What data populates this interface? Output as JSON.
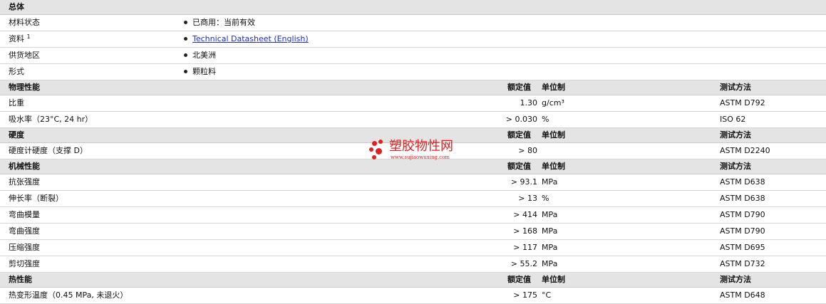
{
  "rows": [
    {
      "type": "hdr",
      "name": "总体"
    },
    {
      "type": "bullet",
      "name": "材料状态",
      "bullet": "已商用：当前有效"
    },
    {
      "type": "bullet",
      "name": "资料",
      "sup": "1",
      "bullet": "Technical Datasheet (English)",
      "link": true
    },
    {
      "type": "bullet",
      "name": "供货地区",
      "bullet": "北美洲"
    },
    {
      "type": "bullet",
      "name": "形式",
      "bullet": "颗粒料"
    },
    {
      "type": "hdr",
      "name": "物理性能",
      "rated": "额定值",
      "unit": "单位制",
      "test": "测试方法"
    },
    {
      "type": "data",
      "name": "比重",
      "value": "1.30",
      "unit": "g/cm³",
      "test": "ASTM D792"
    },
    {
      "type": "data",
      "name": "吸水率（23°C, 24 hr）",
      "value": "> 0.030",
      "unit": "%",
      "test": "ISO 62"
    },
    {
      "type": "hdr",
      "name": "硬度",
      "rated": "额定值",
      "unit": "单位制",
      "test": "测试方法"
    },
    {
      "type": "data",
      "name": "硬度计硬度（支撑 D）",
      "value": "> 80",
      "unit": "",
      "test": "ASTM D2240"
    },
    {
      "type": "hdr",
      "name": "机械性能",
      "rated": "额定值",
      "unit": "单位制",
      "test": "测试方法"
    },
    {
      "type": "data",
      "name": "抗张强度",
      "value": "> 93.1",
      "unit": "MPa",
      "test": "ASTM D638"
    },
    {
      "type": "data",
      "name": "伸长率（断裂）",
      "value": "> 13",
      "unit": "%",
      "test": "ASTM D638"
    },
    {
      "type": "data",
      "name": "弯曲模量",
      "value": "> 414",
      "unit": "MPa",
      "test": "ASTM D790"
    },
    {
      "type": "data",
      "name": "弯曲强度",
      "value": "> 168",
      "unit": "MPa",
      "test": "ASTM D790"
    },
    {
      "type": "data",
      "name": "压缩强度",
      "value": "> 117",
      "unit": "MPa",
      "test": "ASTM D695"
    },
    {
      "type": "data",
      "name": "剪切强度",
      "value": "> 55.2",
      "unit": "MPa",
      "test": "ASTM D732"
    },
    {
      "type": "hdr",
      "name": "热性能",
      "rated": "额定值",
      "unit": "单位制",
      "test": "测试方法"
    },
    {
      "type": "data",
      "name": "热变形温度（0.45 MPa, 未退火）",
      "value": "> 175",
      "unit": "°C",
      "test": "ASTM D648"
    }
  ],
  "watermark": {
    "text": "塑胶物性网",
    "url": "www.sujiaowuxing.com",
    "color": "#e02020"
  }
}
